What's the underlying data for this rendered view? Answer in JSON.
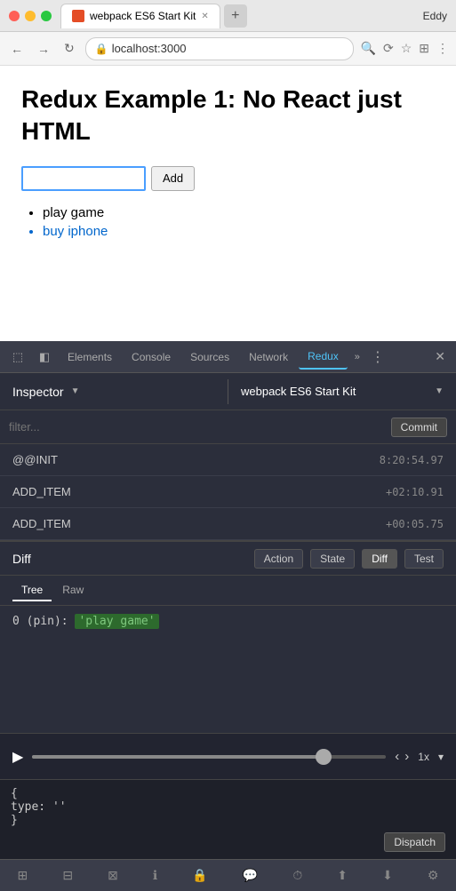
{
  "browser": {
    "user": "Eddy",
    "tab": {
      "title": "webpack ES6 Start Kit",
      "favicon_label": "webpack"
    },
    "url": "localhost:3000",
    "nav": {
      "back": "←",
      "forward": "→",
      "refresh": "↻"
    }
  },
  "page": {
    "title": "Redux Example 1: No React just HTML",
    "input_placeholder": "",
    "add_button": "Add",
    "items": [
      {
        "text": "play game",
        "color": "black"
      },
      {
        "text": "buy iphone",
        "color": "blue"
      }
    ]
  },
  "devtools": {
    "tabs": [
      "Elements",
      "Console",
      "Sources",
      "Network",
      "Redux"
    ],
    "active_tab": "Redux",
    "inspector_label": "Inspector",
    "store_label": "webpack ES6 Start Kit",
    "filter_placeholder": "filter...",
    "commit_label": "Commit",
    "actions": [
      {
        "name": "@@INIT",
        "time": "8:20:54.97"
      },
      {
        "name": "ADD_ITEM",
        "time": "+02:10.91"
      },
      {
        "name": "ADD_ITEM",
        "time": "+00:05.75"
      }
    ],
    "bottom_panel": {
      "label": "Diff",
      "buttons": [
        "Action",
        "State",
        "Diff",
        "Test"
      ],
      "active_button": "Diff",
      "tabs": [
        "Tree",
        "Raw"
      ],
      "active_tab": "Tree",
      "diff_content": {
        "line": "0 (pin):",
        "value": "'play game'"
      }
    },
    "transport": {
      "speed": "1x",
      "slider_pct": 82
    },
    "dispatch": {
      "lines": [
        "{",
        "type: ''",
        "}"
      ],
      "button": "Dispatch"
    },
    "toolbar_icons": [
      "grid2",
      "grid4",
      "grid6",
      "info",
      "lock",
      "chat",
      "timer",
      "upload",
      "download",
      "settings"
    ]
  }
}
